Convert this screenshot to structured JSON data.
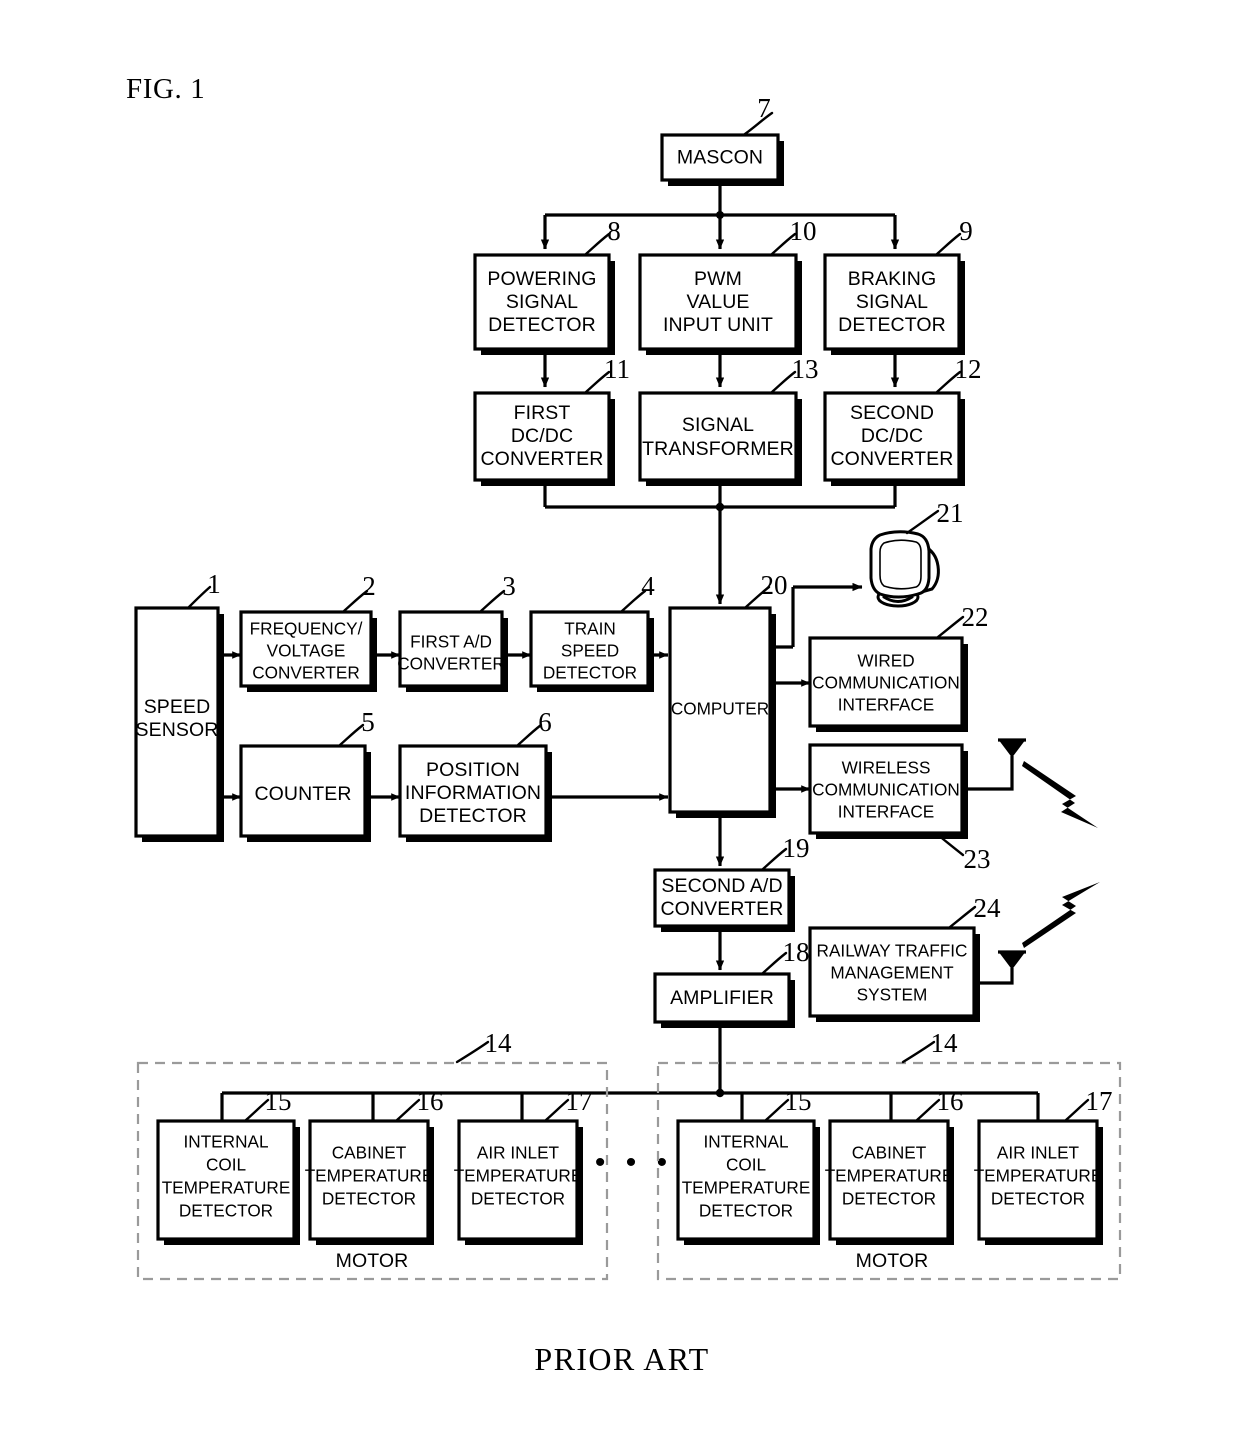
{
  "figure": {
    "label": "FIG. 1",
    "footer": "PRIOR ART",
    "ellipsis": "• • •"
  },
  "blocks": {
    "mascon": {
      "ref": "7",
      "lines": [
        "MASCON"
      ]
    },
    "powering_detector": {
      "ref": "8",
      "lines": [
        "POWERING",
        "SIGNAL",
        "DETECTOR"
      ]
    },
    "pwm_input": {
      "ref": "10",
      "lines": [
        "PWM",
        "VALUE",
        "INPUT UNIT"
      ]
    },
    "braking_detector": {
      "ref": "9",
      "lines": [
        "BRAKING",
        "SIGNAL",
        "DETECTOR"
      ]
    },
    "first_dcdc": {
      "ref": "11",
      "lines": [
        "FIRST",
        "DC/DC",
        "CONVERTER"
      ]
    },
    "signal_transformer": {
      "ref": "13",
      "lines": [
        "SIGNAL",
        "TRANSFORMER"
      ]
    },
    "second_dcdc": {
      "ref": "12",
      "lines": [
        "SECOND",
        "DC/DC",
        "CONVERTER"
      ]
    },
    "speed_sensor": {
      "ref": "1",
      "lines": [
        "SPEED",
        "SENSOR"
      ]
    },
    "freq_volt": {
      "ref": "2",
      "lines": [
        "FREQUENCY/",
        "VOLTAGE",
        "CONVERTER"
      ]
    },
    "first_ad": {
      "ref": "3",
      "lines": [
        "FIRST A/D",
        "CONVERTER"
      ]
    },
    "train_speed": {
      "ref": "4",
      "lines": [
        "TRAIN",
        "SPEED",
        "DETECTOR"
      ]
    },
    "counter": {
      "ref": "5",
      "lines": [
        "COUNTER"
      ]
    },
    "position_info": {
      "ref": "6",
      "lines": [
        "POSITION",
        "INFORMATION",
        "DETECTOR"
      ]
    },
    "computer": {
      "ref": "20",
      "lines": [
        "COMPUTER"
      ]
    },
    "monitor": {
      "ref": "21",
      "lines": []
    },
    "wired_comm": {
      "ref": "22",
      "lines": [
        "WIRED",
        "COMMUNICATION",
        "INTERFACE"
      ]
    },
    "wireless_comm": {
      "ref": "23",
      "lines": [
        "WIRELESS",
        "COMMUNICATION",
        "INTERFACE"
      ]
    },
    "second_ad": {
      "ref": "19",
      "lines": [
        "SECOND A/D",
        "CONVERTER"
      ]
    },
    "amplifier": {
      "ref": "18",
      "lines": [
        "AMPLIFIER"
      ]
    },
    "railway_traffic": {
      "ref": "24",
      "lines": [
        "RAILWAY TRAFFIC",
        "MANAGEMENT",
        "SYSTEM"
      ]
    }
  },
  "motor_groups": [
    {
      "ref": "14",
      "caption": "MOTOR",
      "sensors": [
        {
          "ref": "15",
          "lines": [
            "INTERNAL",
            "COIL",
            "TEMPERATURE",
            "DETECTOR"
          ]
        },
        {
          "ref": "16",
          "lines": [
            "CABINET",
            "TEMPERATURE",
            "DETECTOR"
          ]
        },
        {
          "ref": "17",
          "lines": [
            "AIR INLET",
            "TEMPERATURE",
            "DETECTOR"
          ]
        }
      ]
    },
    {
      "ref": "14",
      "caption": "MOTOR",
      "sensors": [
        {
          "ref": "15",
          "lines": [
            "INTERNAL",
            "COIL",
            "TEMPERATURE",
            "DETECTOR"
          ]
        },
        {
          "ref": "16",
          "lines": [
            "CABINET",
            "TEMPERATURE",
            "DETECTOR"
          ]
        },
        {
          "ref": "17",
          "lines": [
            "AIR INLET",
            "TEMPERATURE",
            "DETECTOR"
          ]
        }
      ]
    }
  ],
  "icons": {
    "monitor": "crt-monitor-icon",
    "antenna_wireless": "antenna-icon",
    "antenna_railway": "antenna-icon",
    "rf_wave_wireless": "lightning-bolt-icon",
    "rf_wave_railway": "lightning-bolt-icon"
  },
  "colors": {
    "ink": "#000000",
    "paper": "#ffffff",
    "dashed": "#9a9a9a"
  }
}
